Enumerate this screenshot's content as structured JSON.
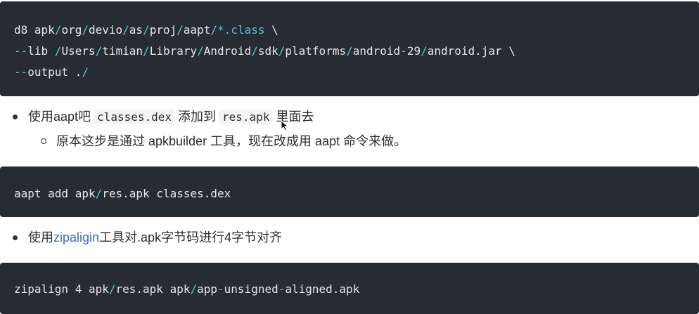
{
  "code_block_1": {
    "lines": [
      [
        {
          "t": "d8 apk",
          "c": "txt"
        },
        {
          "t": "/",
          "c": "op"
        },
        {
          "t": "org",
          "c": "txt"
        },
        {
          "t": "/",
          "c": "op"
        },
        {
          "t": "devio",
          "c": "txt"
        },
        {
          "t": "/",
          "c": "op"
        },
        {
          "t": "as",
          "c": "txt"
        },
        {
          "t": "/",
          "c": "op"
        },
        {
          "t": "proj",
          "c": "txt"
        },
        {
          "t": "/",
          "c": "op"
        },
        {
          "t": "aapt",
          "c": "txt"
        },
        {
          "t": "/*.",
          "c": "op"
        },
        {
          "t": "class",
          "c": "op"
        },
        {
          "t": " \\",
          "c": "txt"
        }
      ],
      [
        {
          "t": "--",
          "c": "op"
        },
        {
          "t": "lib ",
          "c": "txt"
        },
        {
          "t": "/",
          "c": "op"
        },
        {
          "t": "Users",
          "c": "txt"
        },
        {
          "t": "/",
          "c": "op"
        },
        {
          "t": "timian",
          "c": "txt"
        },
        {
          "t": "/",
          "c": "op"
        },
        {
          "t": "Library",
          "c": "txt"
        },
        {
          "t": "/",
          "c": "op"
        },
        {
          "t": "Android",
          "c": "txt"
        },
        {
          "t": "/",
          "c": "op"
        },
        {
          "t": "sdk",
          "c": "txt"
        },
        {
          "t": "/",
          "c": "op"
        },
        {
          "t": "platforms",
          "c": "txt"
        },
        {
          "t": "/",
          "c": "op"
        },
        {
          "t": "android",
          "c": "txt"
        },
        {
          "t": "-",
          "c": "op"
        },
        {
          "t": "29",
          "c": "txt"
        },
        {
          "t": "/",
          "c": "op"
        },
        {
          "t": "android.jar \\",
          "c": "txt"
        }
      ],
      [
        {
          "t": "--",
          "c": "op"
        },
        {
          "t": "output .",
          "c": "txt"
        },
        {
          "t": "/",
          "c": "op"
        }
      ]
    ]
  },
  "bullet_1": {
    "text_before": "使用aapt吧",
    "code_1": "classes.dex",
    "text_middle": "添加到",
    "code_2": "res.apk",
    "text_after": "里面去"
  },
  "sub_bullet_1": {
    "text": "原本这步是通过 apkbuilder 工具，现在改成用 aapt 命令来做。"
  },
  "code_block_2": {
    "lines": [
      [
        {
          "t": "aapt add apk",
          "c": "txt"
        },
        {
          "t": "/",
          "c": "op"
        },
        {
          "t": "res.apk classes.dex",
          "c": "txt"
        }
      ]
    ]
  },
  "bullet_2": {
    "text_before": "使用",
    "link": "zipaligin",
    "text_after": "工具对.apk字节码进行4字节对齐"
  },
  "code_block_3": {
    "lines": [
      [
        {
          "t": "zipalign 4 apk",
          "c": "txt"
        },
        {
          "t": "/",
          "c": "op"
        },
        {
          "t": "res.apk apk",
          "c": "txt"
        },
        {
          "t": "/",
          "c": "op"
        },
        {
          "t": "app",
          "c": "txt"
        },
        {
          "t": "-",
          "c": "op"
        },
        {
          "t": "unsigned",
          "c": "txt"
        },
        {
          "t": "-",
          "c": "op"
        },
        {
          "t": "aligned.apk",
          "c": "txt"
        }
      ]
    ]
  },
  "colors": {
    "code_background": "#272b33",
    "code_text": "#e6e8ec",
    "code_operator": "#5fc1d6",
    "link": "#3f6cbf"
  },
  "icons": [
    "mouse-cursor-icon"
  ]
}
